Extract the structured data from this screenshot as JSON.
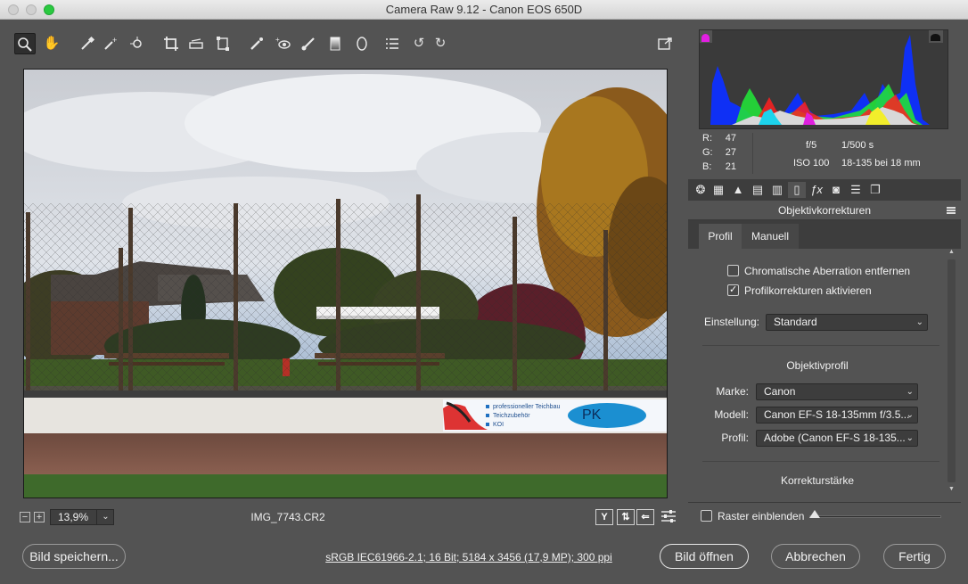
{
  "window": {
    "title": "Camera Raw 9.12 - Canon EOS 650D"
  },
  "toolbar": {
    "tools": [
      "zoom-tool-icon",
      "hand-tool-icon",
      "white-balance-icon",
      "color-sampler-icon",
      "targeted-adjustment-icon",
      "crop-icon",
      "straighten-icon",
      "transform-icon",
      "spot-removal-icon",
      "red-eye-icon",
      "adjustment-brush-icon",
      "graduated-filter-icon",
      "radial-filter-icon",
      "preferences-list-icon",
      "rotate-left-icon",
      "rotate-right-icon"
    ],
    "fullscreen": "fullscreen-toggle-icon"
  },
  "readout": {
    "r_label": "R:",
    "r_value": "47",
    "g_label": "G:",
    "g_value": "27",
    "b_label": "B:",
    "b_value": "21",
    "aperture": "f/5",
    "shutter": "1/500 s",
    "iso": "ISO 100",
    "lens": "18-135 bei 18 mm"
  },
  "panel": {
    "title": "Objektivkorrekturen",
    "tabs": {
      "profil": "Profil",
      "manuell": "Manuell"
    },
    "chromatic": "Chromatische Aberration entfernen",
    "profile_corrections": "Profilkorrekturen aktivieren",
    "setting_label": "Einstellung:",
    "setting_value": "Standard",
    "lens_profile_title": "Objektivprofil",
    "make_label": "Marke:",
    "make_value": "Canon",
    "model_label": "Modell:",
    "model_value": "Canon EF-S 18-135mm f/3.5...",
    "profile_label": "Profil:",
    "profile_value": "Adobe (Canon EF-S 18-135...",
    "strength_title": "Korrekturstärke",
    "grid_label": "Raster einblenden"
  },
  "statusbar": {
    "zoom_minus": "−",
    "zoom_plus": "+",
    "zoom_value": "13,9%",
    "filename": "IMG_7743.CR2",
    "compare_y": "Y"
  },
  "photo": {
    "sign_line1": "professioneller Teichbau",
    "sign_line2": "Teichzubehör",
    "sign_line3": "KOI",
    "sign_logo": "PK"
  },
  "footer": {
    "save": "Bild speichern...",
    "info": "sRGB IEC61966-2.1; 16 Bit; 5184 x 3456 (17,9 MP); 300 ppi",
    "open": "Bild öffnen",
    "cancel": "Abbrechen",
    "done": "Fertig"
  },
  "colors": {
    "accent_clip_shadow": "#e21fe2",
    "panel_bg": "#535353",
    "dark_bg": "#3d3d3d"
  }
}
